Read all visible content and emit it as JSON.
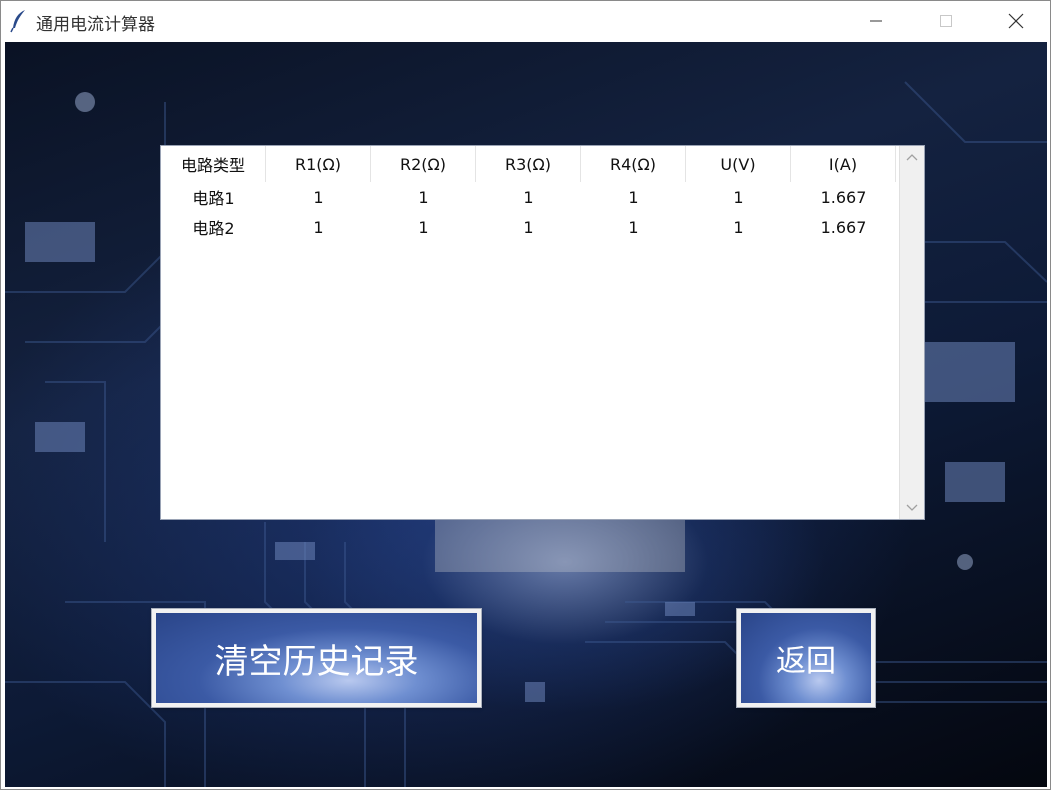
{
  "window": {
    "title": "通用电流计算器",
    "icon": "feather-icon"
  },
  "table": {
    "columns": [
      "电路类型",
      "R1(Ω)",
      "R2(Ω)",
      "R3(Ω)",
      "R4(Ω)",
      "U(V)",
      "I(A)"
    ],
    "rows": [
      [
        "电路1",
        "1",
        "1",
        "1",
        "1",
        "1",
        "1.667"
      ],
      [
        "电路2",
        "1",
        "1",
        "1",
        "1",
        "1",
        "1.667"
      ]
    ]
  },
  "buttons": {
    "clear_history": "清空历史记录",
    "back": "返回"
  }
}
